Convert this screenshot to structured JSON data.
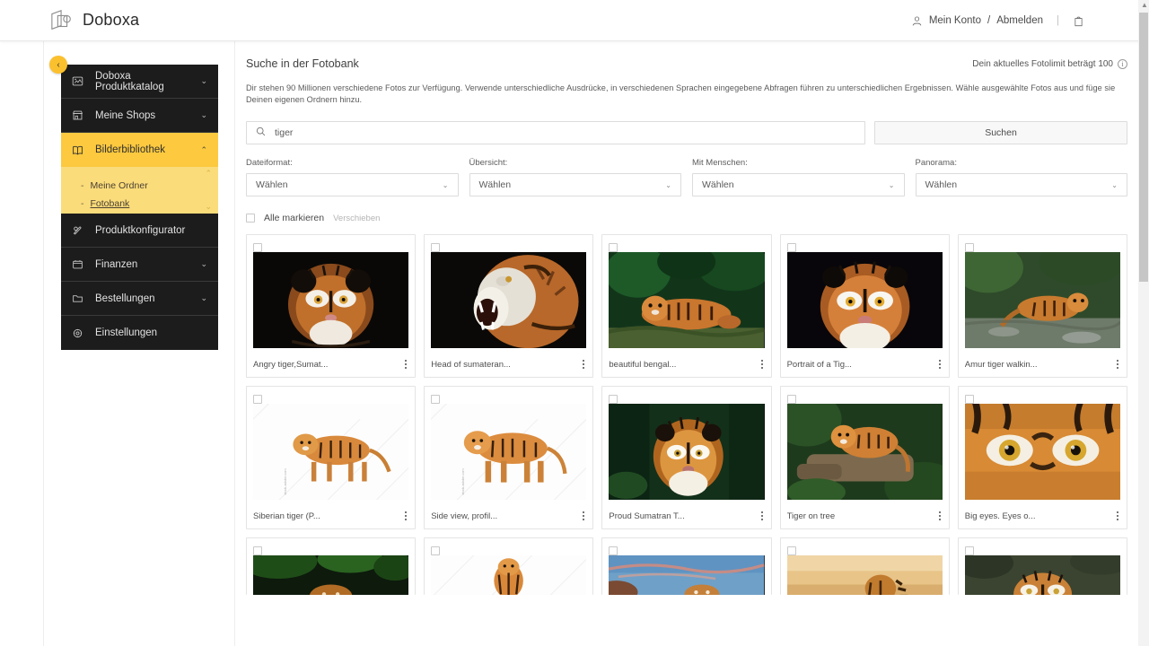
{
  "header": {
    "brand": "Doboxa",
    "account_label": "Mein Konto",
    "separator": "/",
    "logout_label": "Abmelden",
    "divider": "|",
    "user_icon": "user-icon",
    "bag_icon": "shopping-bag-icon"
  },
  "sidebar": {
    "collapse_icon": "‹",
    "items": [
      {
        "label": "Doboxa Produktkatalog",
        "icon": "catalog-icon",
        "chevron": "⌄",
        "active": false
      },
      {
        "label": "Meine Shops",
        "icon": "shop-icon",
        "chevron": "⌄",
        "active": false
      },
      {
        "label": "Bilderbibliothek",
        "icon": "book-icon",
        "chevron": "⌃",
        "active": true
      },
      {
        "label": "Produktkonfigurator",
        "icon": "configurator-icon",
        "chevron": "",
        "active": false
      },
      {
        "label": "Finanzen",
        "icon": "wallet-icon",
        "chevron": "⌄",
        "active": false
      },
      {
        "label": "Bestellungen",
        "icon": "folder-icon",
        "chevron": "⌄",
        "active": false
      },
      {
        "label": "Einstellungen",
        "icon": "settings-icon",
        "chevron": "",
        "active": false
      }
    ],
    "submenu": [
      {
        "dash": "-",
        "label": "Meine Ordner",
        "selected": false
      },
      {
        "dash": "-",
        "label": "Fotobank",
        "selected": true
      }
    ],
    "submenu_scroll_up": "⌃",
    "submenu_scroll_down": "⌄"
  },
  "main": {
    "page_title": "Suche in der Fotobank",
    "limit_text": "Dein aktuelles Fotolimit beträgt 100",
    "limit_info_icon": "i",
    "description": "Dir stehen 90 Millionen verschiedene Fotos zur Verfügung. Verwende unterschiedliche Ausdrücke, in verschiedenen Sprachen eingegebene Abfragen führen zu unterschiedlichen Ergebnissen. Wähle ausgewählte Fotos aus und füge sie Deinen eigenen Ordnern hinzu.",
    "search": {
      "icon": "search-icon",
      "value": "tiger",
      "placeholder": "",
      "button_label": "Suchen"
    },
    "filters": [
      {
        "label": "Dateiformat:",
        "value": "Wählen",
        "chevron": "⌄"
      },
      {
        "label": "Übersicht:",
        "value": "Wählen",
        "chevron": "⌄"
      },
      {
        "label": "Mit Menschen:",
        "value": "Wählen",
        "chevron": "⌄"
      },
      {
        "label": "Panorama:",
        "value": "Wählen",
        "chevron": "⌄"
      }
    ],
    "select_all_label": "Alle markieren",
    "move_label": "Verschieben",
    "cards": [
      {
        "title": "Angry tiger,Sumat...",
        "menu_icon": "kebab-menu-icon",
        "style": "dark-face"
      },
      {
        "title": "Head of sumateran...",
        "menu_icon": "kebab-menu-icon",
        "style": "roar"
      },
      {
        "title": "beautiful bengal...",
        "menu_icon": "kebab-menu-icon",
        "style": "jungle-lying"
      },
      {
        "title": "Portrait of a Tig...",
        "menu_icon": "kebab-menu-icon",
        "style": "dark-portrait"
      },
      {
        "title": "Amur tiger walkin...",
        "menu_icon": "kebab-menu-icon",
        "style": "river-walk"
      },
      {
        "title": "Siberian tiger (P...",
        "menu_icon": "kebab-menu-icon",
        "style": "white-bg-walk"
      },
      {
        "title": "Side view, profil...",
        "menu_icon": "kebab-menu-icon",
        "style": "white-bg-stand"
      },
      {
        "title": "Proud Sumatran T...",
        "menu_icon": "kebab-menu-icon",
        "style": "green-portrait"
      },
      {
        "title": "Tiger on tree",
        "menu_icon": "kebab-menu-icon",
        "style": "on-tree"
      },
      {
        "title": "Big eyes. Eyes o...",
        "menu_icon": "kebab-menu-icon",
        "style": "eyes-closeup"
      }
    ],
    "cards_partial": [
      {
        "style": "cave"
      },
      {
        "style": "white-front"
      },
      {
        "style": "sunset-sky"
      },
      {
        "style": "golden-grass"
      },
      {
        "style": "forest-face"
      }
    ]
  },
  "colors": {
    "accent": "#fcc93f",
    "submenu_bg": "#fbdc7a",
    "nav_bg": "#1c1c1c"
  }
}
